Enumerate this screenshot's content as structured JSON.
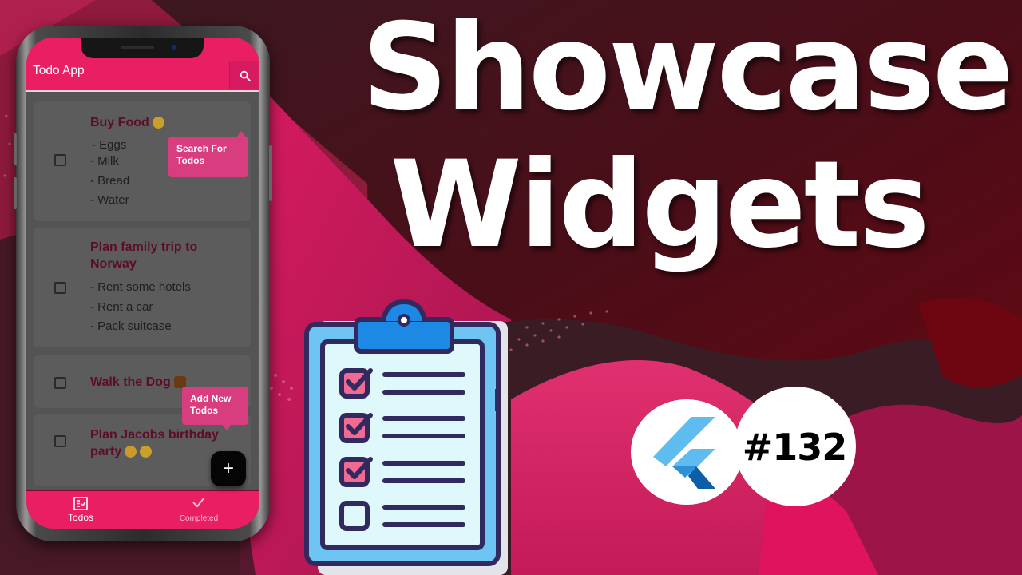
{
  "thumbnail": {
    "headline_line1": "Showcase",
    "headline_line2": "Widgets",
    "episode_badge": "#132",
    "logo": "flutter-logo-icon",
    "illustration": "clipboard-checklist-icon"
  },
  "app": {
    "title": "Todo App",
    "search_icon": "search-icon",
    "tooltips": {
      "search": "Search For Todos",
      "search_line1": "Search For",
      "search_line2": "Todos",
      "add": "Add New Todos",
      "add_line1": "Add New",
      "add_line2": "Todos"
    },
    "fab_label": "+",
    "todos": [
      {
        "title": "Buy Food",
        "emoji": "yum-face-emoji",
        "checked": false,
        "items": [
          "- Eggs",
          "- Milk",
          "- Bread",
          "- Water"
        ]
      },
      {
        "title_line1": "Plan family trip to",
        "title_line2": "Norway",
        "checked": false,
        "items": [
          "- Rent some hotels",
          "- Rent a car",
          "- Pack suitcase"
        ]
      },
      {
        "title": "Walk the Dog",
        "emoji": "dog-emoji",
        "checked": false,
        "items": []
      },
      {
        "title_line1": "Plan Jacobs birthday",
        "title_line2": "party",
        "emoji": "party-popper-emoji",
        "checked": false,
        "items": []
      }
    ],
    "bottom_nav": [
      {
        "label": "Todos",
        "icon": "checklist-icon",
        "active": true
      },
      {
        "label": "Completed",
        "icon": "check-icon",
        "active": false
      }
    ]
  },
  "colors": {
    "primary": "#e91e63",
    "tooltip": "#d83d7f",
    "todo_title": "#5e0d26",
    "overlay": "#555555",
    "fab": "#050505",
    "background_dark_red": "#5a0a14",
    "background_pink": "#c2185b"
  }
}
